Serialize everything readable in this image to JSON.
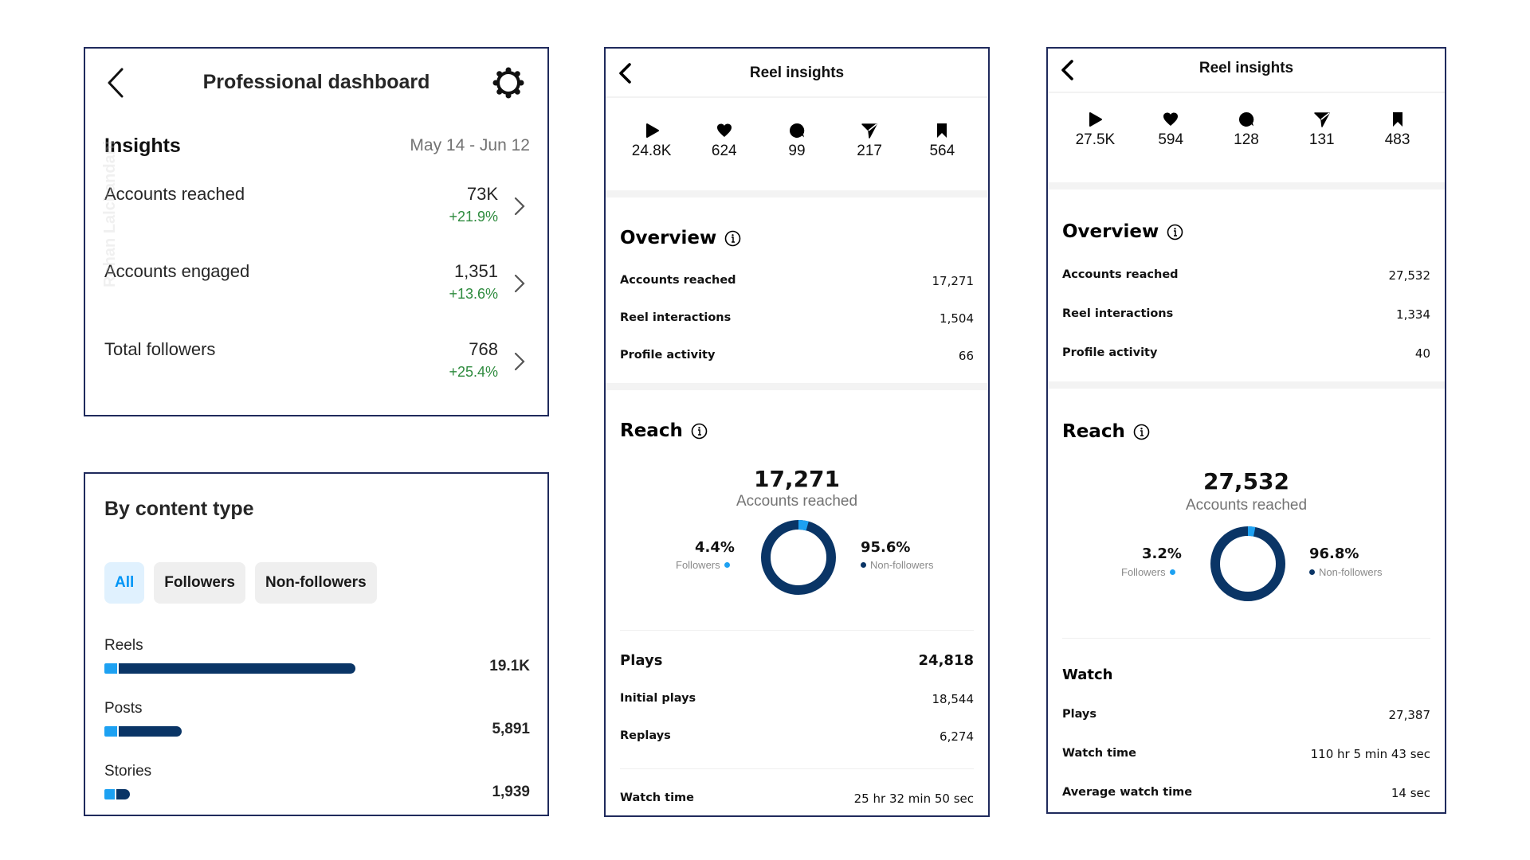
{
  "dashboard": {
    "title": "Professional dashboard",
    "section": "Insights",
    "date_range": "May 14 - Jun 12",
    "metrics": [
      {
        "label": "Accounts reached",
        "value": "73K",
        "change": "+21.9%"
      },
      {
        "label": "Accounts engaged",
        "value": "1,351",
        "change": "+13.6%"
      },
      {
        "label": "Total followers",
        "value": "768",
        "change": "+25.4%"
      }
    ]
  },
  "content_type": {
    "title": "By content type",
    "filters": [
      {
        "label": "All",
        "active": true
      },
      {
        "label": "Followers",
        "active": false
      },
      {
        "label": "Non-followers",
        "active": false
      }
    ],
    "rows": [
      {
        "label": "Reels",
        "value": "19.1K",
        "numeric": 19100,
        "followers_share": 0.05
      },
      {
        "label": "Posts",
        "value": "5,891",
        "numeric": 5891,
        "followers_share": 0.17
      },
      {
        "label": "Stories",
        "value": "1,939",
        "numeric": 1939,
        "followers_share": 0.4
      }
    ]
  },
  "reel1": {
    "title": "Reel insights",
    "stats": [
      {
        "icon": "play-icon",
        "value": "24.8K"
      },
      {
        "icon": "heart-icon",
        "value": "624"
      },
      {
        "icon": "comment-icon",
        "value": "99"
      },
      {
        "icon": "share-icon",
        "value": "217"
      },
      {
        "icon": "bookmark-icon",
        "value": "564"
      }
    ],
    "overview_title": "Overview",
    "overview": [
      {
        "label": "Accounts reached",
        "value": "17,271"
      },
      {
        "label": "Reel interactions",
        "value": "1,504"
      },
      {
        "label": "Profile activity",
        "value": "66"
      }
    ],
    "reach_title": "Reach",
    "reach_total": "17,271",
    "reach_caption": "Accounts reached",
    "followers_pct_label": "4.4%",
    "followers_pct": 4.4,
    "followers_label": "Followers",
    "nonfollowers_pct_label": "95.6%",
    "nonfollowers_label": "Non-followers",
    "plays": [
      {
        "label": "Plays",
        "value": "24,818"
      },
      {
        "label": "Initial plays",
        "value": "18,544"
      },
      {
        "label": "Replays",
        "value": "6,274"
      }
    ],
    "watch_time": {
      "label": "Watch time",
      "value": "25 hr 32 min 50 sec"
    }
  },
  "reel2": {
    "title": "Reel insights",
    "stats": [
      {
        "icon": "play-icon",
        "value": "27.5K"
      },
      {
        "icon": "heart-icon",
        "value": "594"
      },
      {
        "icon": "comment-icon",
        "value": "128"
      },
      {
        "icon": "share-icon",
        "value": "131"
      },
      {
        "icon": "bookmark-icon",
        "value": "483"
      }
    ],
    "overview_title": "Overview",
    "overview": [
      {
        "label": "Accounts reached",
        "value": "27,532"
      },
      {
        "label": "Reel interactions",
        "value": "1,334"
      },
      {
        "label": "Profile activity",
        "value": "40"
      }
    ],
    "reach_title": "Reach",
    "reach_total": "27,532",
    "reach_caption": "Accounts reached",
    "followers_pct_label": "3.2%",
    "followers_pct": 3.2,
    "followers_label": "Followers",
    "nonfollowers_pct_label": "96.8%",
    "nonfollowers_label": "Non-followers",
    "watch_title": "Watch",
    "watch": [
      {
        "label": "Plays",
        "value": "27,387"
      },
      {
        "label": "Watch time",
        "value": "110 hr 5 min 43 sec"
      },
      {
        "label": "Average watch time",
        "value": "14 sec"
      }
    ]
  },
  "watermark": "Rohan Lalchandani",
  "colors": {
    "followers": "#1da1f2",
    "non_followers": "#0a3566",
    "positive_change": "#2e8b3e",
    "panel_border": "#1f2a5c",
    "chip_active_bg": "#e0f1fe",
    "chip_active_text": "#0095f6"
  }
}
